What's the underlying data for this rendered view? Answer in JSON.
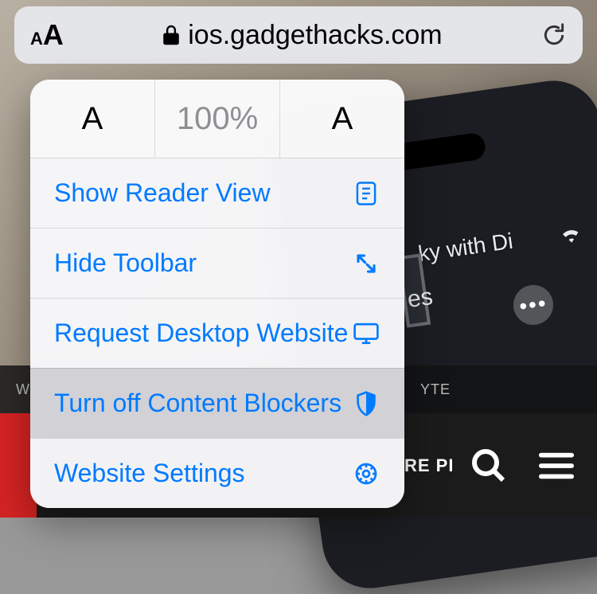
{
  "address_bar": {
    "url": "ios.gadgethacks.com"
  },
  "popover": {
    "zoom": {
      "decrease_label": "A",
      "level": "100%",
      "increase_label": "A"
    },
    "items": [
      {
        "label": "Show Reader View"
      },
      {
        "label": "Hide Toolbar"
      },
      {
        "label": "Request Desktop Website"
      },
      {
        "label": "Turn off Content Blockers"
      },
      {
        "label": "Website Settings"
      }
    ]
  },
  "background": {
    "song_fragment": "ky with Di",
    "word_fragment": "es",
    "band_left_fragment": "WO",
    "band_right_fragment": "YTE",
    "bottom_fragment": "RE PI"
  }
}
